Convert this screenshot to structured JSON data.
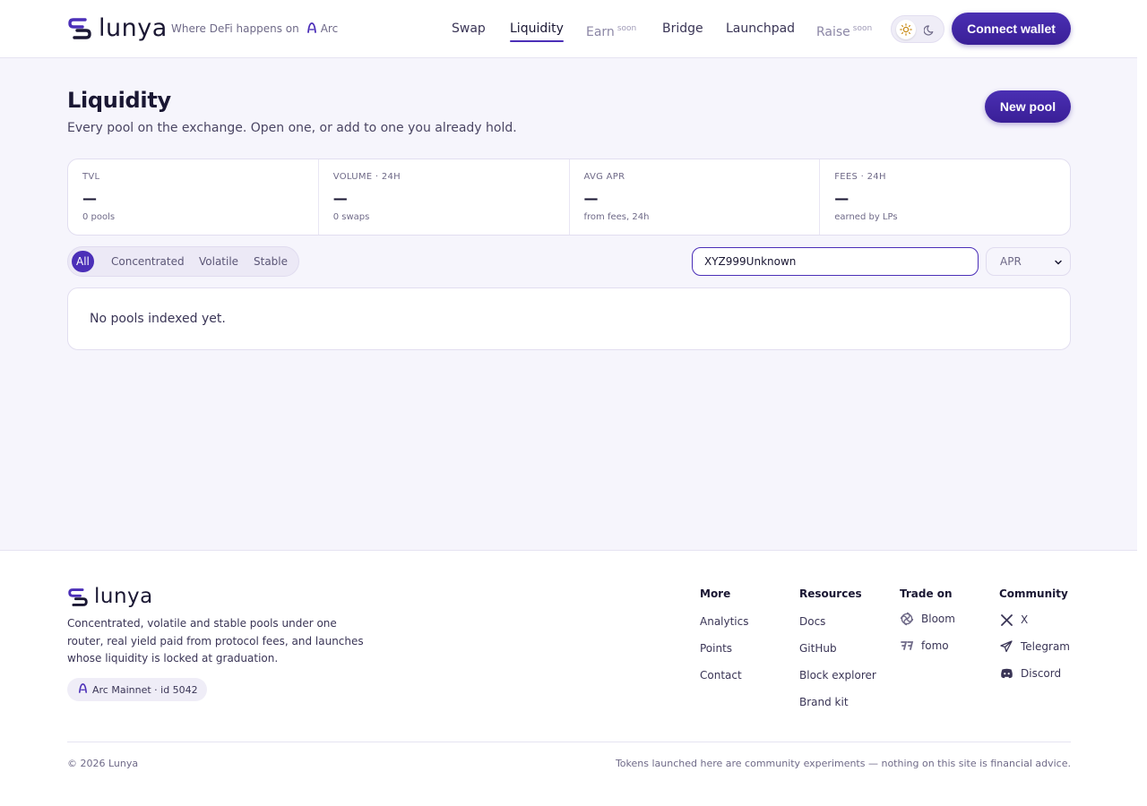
{
  "brand": {
    "name": "lunya",
    "accent": "#4b2fb8"
  },
  "header": {
    "tagline": "Where DeFi happens on",
    "network_name": "Arc",
    "nav": [
      {
        "label": "Swap"
      },
      {
        "label": "Liquidity",
        "active": true
      },
      {
        "label": "Earn",
        "badge": "soon"
      },
      {
        "label": "Bridge"
      },
      {
        "label": "Launchpad"
      },
      {
        "label": "Raise",
        "badge": "soon"
      }
    ],
    "theme_icons": [
      "sun-icon",
      "moon-icon"
    ],
    "connect_label": "Connect wallet"
  },
  "page": {
    "title": "Liquidity",
    "subtitle": "Every pool on the exchange. Open one, or add to one you already hold.",
    "new_pool_label": "New pool"
  },
  "stats": [
    {
      "label": "TVL",
      "value": "—",
      "sub": "0 pools"
    },
    {
      "label": "VOLUME · 24H",
      "value": "—",
      "sub": "0 swaps"
    },
    {
      "label": "AVG APR",
      "value": "—",
      "sub": "from fees, 24h"
    },
    {
      "label": "FEES · 24H",
      "value": "—",
      "sub": "earned by LPs"
    }
  ],
  "filters": {
    "types": [
      "All",
      "Concentrated",
      "Volatile",
      "Stable"
    ],
    "active": "All",
    "search_value": "XYZ999Unknown",
    "sort_value": "APR"
  },
  "pools": {
    "empty_text": "No pools indexed yet."
  },
  "footer": {
    "description": "Concentrated, volatile and stable pools under one router, real yield paid from protocol fees, and launches whose liquidity is locked at graduation.",
    "network_badge": "Arc Mainnet · id 5042",
    "columns": [
      {
        "title": "More",
        "links": [
          {
            "label": "Analytics"
          },
          {
            "label": "Points"
          },
          {
            "label": "Contact"
          }
        ]
      },
      {
        "title": "Resources",
        "links": [
          {
            "label": "Docs"
          },
          {
            "label": "GitHub"
          },
          {
            "label": "Block explorer"
          },
          {
            "label": "Brand kit"
          }
        ]
      },
      {
        "title": "Trade on",
        "links": [
          {
            "label": "Bloom",
            "icon": "bloom-icon"
          },
          {
            "label": "fomo",
            "icon": "fomo-icon"
          }
        ]
      },
      {
        "title": "Community",
        "links": [
          {
            "label": "X",
            "icon": "x-icon"
          },
          {
            "label": "Telegram",
            "icon": "telegram-icon"
          },
          {
            "label": "Discord",
            "icon": "discord-icon"
          }
        ]
      }
    ],
    "copyright": "© 2026 Lunya",
    "disclaimer": "Tokens launched here are community experiments — nothing on this site is financial advice."
  }
}
